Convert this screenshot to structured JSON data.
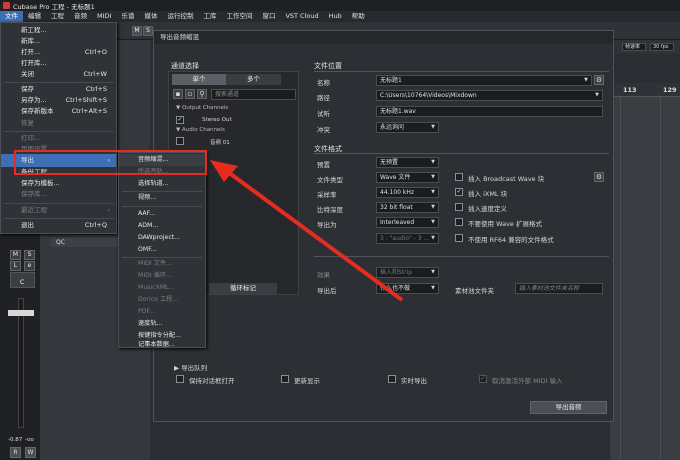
{
  "window": {
    "title": "Cubase Pro 工程 - 无标题1"
  },
  "menubar": [
    "文件",
    "编辑",
    "工程",
    "音频",
    "MIDI",
    "乐谱",
    "媒体",
    "运行控制",
    "工库",
    "工作空间",
    "窗口",
    "VST Cloud",
    "Hub",
    "帮助"
  ],
  "transport": {
    "m": "M",
    "s": "S",
    "rate_label": "帧速率",
    "fps": "30 fps"
  },
  "ruler": {
    "n1": "113",
    "n2": "129"
  },
  "file_menu": {
    "items": [
      {
        "label": "新工程...",
        "shortcut": ""
      },
      {
        "label": "新库...",
        "shortcut": ""
      },
      {
        "label": "打开...",
        "shortcut": "Ctrl+O"
      },
      {
        "label": "打开库...",
        "shortcut": ""
      },
      {
        "label": "关闭",
        "shortcut": "Ctrl+W"
      },
      {
        "label": "保存",
        "shortcut": "Ctrl+S"
      },
      {
        "label": "另存为...",
        "shortcut": "Ctrl+Shift+S"
      },
      {
        "label": "保存新版本",
        "shortcut": "Ctrl+Alt+S"
      },
      {
        "label": "恢复",
        "shortcut": ""
      },
      {
        "label": "打印...",
        "shortcut": ""
      },
      {
        "label": "页面设置...",
        "shortcut": ""
      },
      {
        "label": "导入",
        "shortcut": ""
      },
      {
        "label": "导出",
        "shortcut": ""
      },
      {
        "label": "备份工程...",
        "shortcut": ""
      },
      {
        "label": "保存为模板...",
        "shortcut": ""
      },
      {
        "label": "保存库...",
        "shortcut": ""
      },
      {
        "label": "最近工程",
        "shortcut": ""
      },
      {
        "label": "退出",
        "shortcut": "Ctrl+Q"
      }
    ]
  },
  "export_submenu": {
    "items": [
      "音频缩混...",
      "所选音轨...",
      "选择轨道...",
      "视频...",
      "AAF...",
      "ADM...",
      "DAWproject...",
      "OMF...",
      "MIDI 文件...",
      "MIDI 循环...",
      "MusicXML...",
      "Dorico 工程...",
      "PDF...",
      "速度轨...",
      "按键指令分配...",
      "记事本数据..."
    ]
  },
  "left_strip": {
    "track_label": "QC",
    "volume": "-0.87",
    "pan": "-oo",
    "r": "R",
    "w": "W",
    "l": "L",
    "c": "C",
    "m": "M",
    "s": "S",
    "e": "e"
  },
  "dialog": {
    "title": "导出音频缩混",
    "channel_section": {
      "title": "通道选择",
      "tab_single": "单个",
      "tab_multi": "多个",
      "search_placeholder": "搜索通道",
      "output_group": "Output Channels",
      "stereo_out": "Stereo Out",
      "audio_group": "Audio Channels",
      "audio_track": "音频 01"
    },
    "tab_loop": "循环标记",
    "file_location": {
      "title": "文件位置",
      "name_label": "名称",
      "name_value": "无标题1",
      "path_label": "路径",
      "path_value": "C:\\Users\\10764\\Videos\\Mixdown",
      "preview_label": "试听",
      "preview_value": "无标题1.wav",
      "conflict_label": "冲突",
      "conflict_value": "永远询问"
    },
    "file_format": {
      "title": "文件格式",
      "preset_label": "预置",
      "preset_value": "无预置",
      "type_label": "文件类型",
      "type_value": "Wave 文件",
      "rate_label": "采样率",
      "rate_value": "44.100 kHz",
      "depth_label": "比特深度",
      "depth_value": "32 bit float",
      "export_as_label": "导出为",
      "export_as_value": "Interleaved",
      "naming_value": "3 : \"audio\" - 3 ...",
      "opt_bwf": "插入 Broadcast Wave 块",
      "opt_ixml": "插入 iXML 块",
      "opt_tempo": "插入速度定义",
      "opt_no_wave_ext": "不要使用 Wave 扩展格式",
      "opt_no_rf64": "不使用 RF64 兼容的文件格式"
    },
    "after_export": {
      "effects_label": "效果",
      "effects_value": "插入和Strip",
      "after_label": "导出后",
      "after_value": "什么也不做",
      "pool_label": "素材池文件夹",
      "pool_placeholder": "插入素材池文件夹名称"
    },
    "queue": {
      "label": "导出队列",
      "keep_open": "保持对话框打开",
      "update_display": "更新显示",
      "realtime": "实时导出",
      "cancel_midi": "取消激活外部 MIDI 输入"
    },
    "export_button": "导出音频"
  }
}
